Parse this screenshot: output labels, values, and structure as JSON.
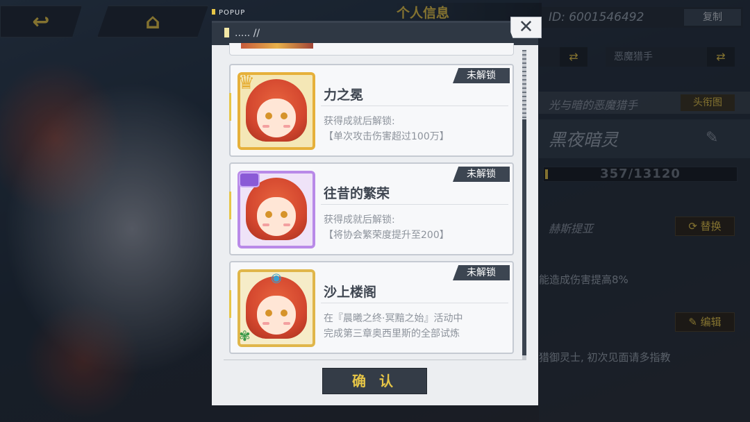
{
  "popup": {
    "tag": "POPUP",
    "header_text": "..... //",
    "confirm_label": "确 认",
    "close_label": "✕"
  },
  "cards": [
    {
      "title": "力之冕",
      "badge": "未解锁",
      "desc_line1": "获得成就后解锁:",
      "desc_line2": "【单次攻击伤害超过100万】",
      "frame_color": "#e6b03a"
    },
    {
      "title": "往昔的繁荣",
      "badge": "未解锁",
      "desc_line1": "获得成就后解锁:",
      "desc_line2": "【将协会繁荣度提升至200】",
      "frame_color": "#b98ae8"
    },
    {
      "title": "沙上楼阁",
      "badge": "未解锁",
      "desc_line1": "在『晨曦之终·冥黯之始』活动中",
      "desc_line2": "完成第三章奥西里斯的全部试炼",
      "frame_color": "#e0b64a"
    }
  ],
  "profile": {
    "title": "个人信息",
    "id_text": "ID: 6001546492",
    "copy_label": "复制",
    "selector_right": "恶魔猎手",
    "bar_light_text": "光与暗的恶魔猎手",
    "tag_label": "头衔图",
    "name": "黑夜暗灵",
    "exp": "357/13120",
    "heroine": "赫斯提亚",
    "switch_label": "替换",
    "skill_text": "能造成伤害提高8%",
    "edit_label": "编辑",
    "signature": "猎御灵士, 初次见面请多指教"
  },
  "nav": {
    "back_icon": "↩",
    "home_icon": "⌂"
  }
}
